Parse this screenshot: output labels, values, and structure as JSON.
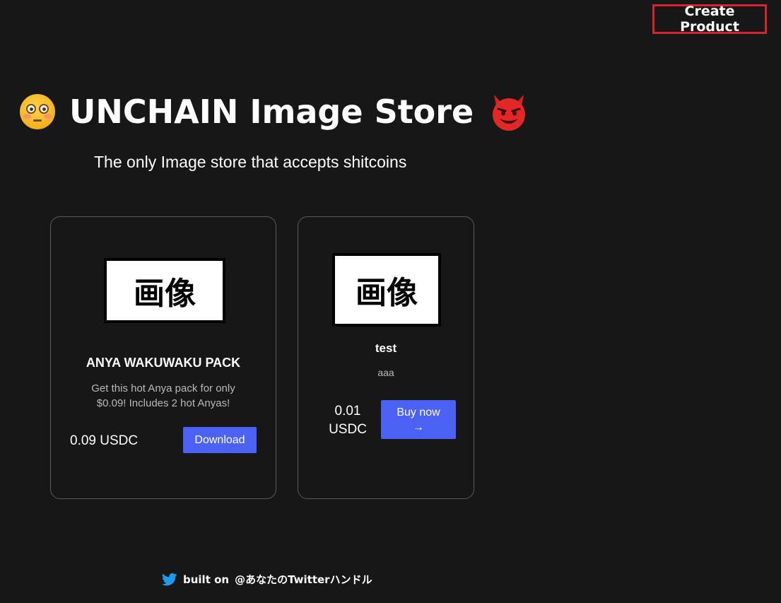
{
  "header": {
    "create_product_label": "Create Product"
  },
  "hero": {
    "title": "UNCHAIN Image Store",
    "left_emoji": "flushed-face-icon",
    "right_emoji": "smiling-devil-icon",
    "subtitle": "The only Image store that accepts shitcoins"
  },
  "products": [
    {
      "thumbnail_text": "画像",
      "name": "ANYA WAKUWAKU PACK",
      "description": "Get this hot Anya pack for only $0.09! Includes 2 hot Anyas!",
      "price": "0.09 USDC",
      "action_label": "Download"
    },
    {
      "thumbnail_text": "画像",
      "name": "test",
      "description": "aaa",
      "price_amount": "0.01",
      "price_currency": "USDC",
      "action_label": "Buy now",
      "action_arrow": "→"
    }
  ],
  "footer": {
    "icon": "twitter-icon",
    "prefix": "built on",
    "handle": "@あなたのTwitterハンドル"
  },
  "colors": {
    "background": "#171717",
    "accent_button": "#4b62f4",
    "highlight_border": "#d6232c",
    "card_border": "#5a5a5a",
    "muted_text": "#b9b9b9",
    "twitter_blue": "#1d9bf0"
  }
}
